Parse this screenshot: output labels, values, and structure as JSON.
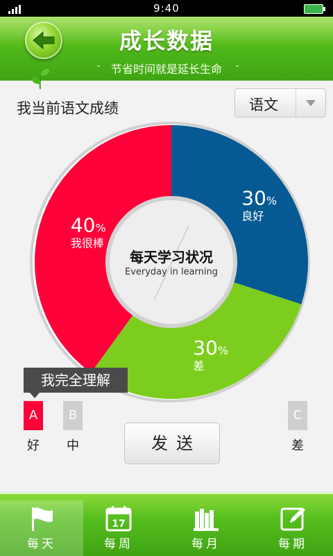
{
  "status_bar": {
    "time": "9:40"
  },
  "header": {
    "title": "成长数据",
    "subtitle": "节省时间就是延长生命"
  },
  "grade": {
    "label": "我当前语文成绩"
  },
  "subject_select": {
    "value": "语文"
  },
  "chart_data": {
    "type": "pie",
    "center_title": "每天学习状况",
    "center_subtitle": "Everyday in learning",
    "slices": [
      {
        "label": "良好",
        "value": 30,
        "value_text": "30",
        "unit": "%",
        "color": "#055a93"
      },
      {
        "label": "差",
        "value": 30,
        "value_text": "30",
        "unit": "%",
        "color": "#7dcd1e"
      },
      {
        "label": "我很棒",
        "value": 40,
        "value_text": "40",
        "unit": "%",
        "color": "#ff0038"
      }
    ]
  },
  "tooltip": {
    "text": "我完全理解"
  },
  "options": [
    {
      "key": "A",
      "label": "好",
      "color": "#ff0038"
    },
    {
      "key": "B",
      "label": "中",
      "color": "#cfcfcf"
    },
    {
      "key": "C",
      "label": "差",
      "color": "#cfcfcf"
    }
  ],
  "send_button": {
    "label": "发送"
  },
  "tabs": [
    {
      "label": "每天",
      "icon": "flag-icon",
      "active": true
    },
    {
      "label": "每周",
      "icon": "calendar-icon",
      "calendar_day": "17"
    },
    {
      "label": "每月",
      "icon": "books-icon"
    },
    {
      "label": "每期",
      "icon": "edit-icon"
    }
  ]
}
